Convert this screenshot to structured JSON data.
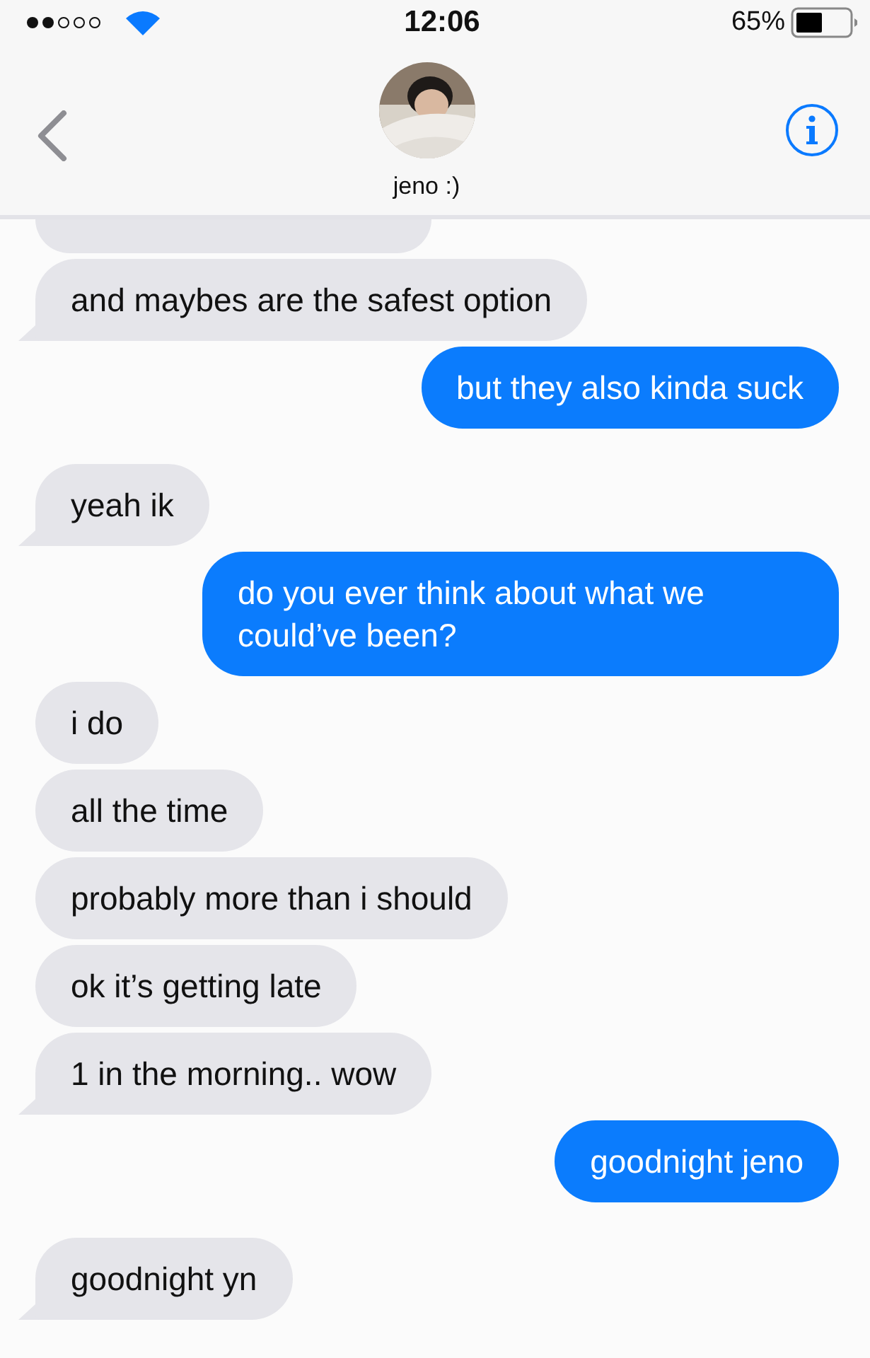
{
  "status_bar": {
    "time": "12:06",
    "battery": "65%"
  },
  "header": {
    "contact": "jeno :)"
  },
  "messages": [
    {
      "kind": "partial",
      "tail": false,
      "gap_before": false
    },
    {
      "kind": "received",
      "text": "and maybes are the safest option",
      "tail": true,
      "gap_before": false
    },
    {
      "kind": "sent",
      "text": "but they also kinda suck",
      "tail": false,
      "gap_before": false
    },
    {
      "kind": "received",
      "text": "yeah ik",
      "tail": true,
      "gap_before": true
    },
    {
      "kind": "sent",
      "text": "do you ever think about what we could’ve been?",
      "tail": false,
      "gap_before": false
    },
    {
      "kind": "received",
      "text": "i do",
      "tail": false,
      "gap_before": false
    },
    {
      "kind": "received",
      "text": "all the time",
      "tail": false,
      "gap_before": false
    },
    {
      "kind": "received",
      "text": "probably more than i should",
      "tail": false,
      "gap_before": false
    },
    {
      "kind": "received",
      "text": "ok it’s getting late",
      "tail": false,
      "gap_before": false
    },
    {
      "kind": "received",
      "text": "1 in the morning.. wow",
      "tail": true,
      "gap_before": false
    },
    {
      "kind": "sent",
      "text": "goodnight jeno",
      "tail": false,
      "gap_before": false
    },
    {
      "kind": "received",
      "text": "goodnight yn",
      "tail": true,
      "gap_before": true
    }
  ]
}
